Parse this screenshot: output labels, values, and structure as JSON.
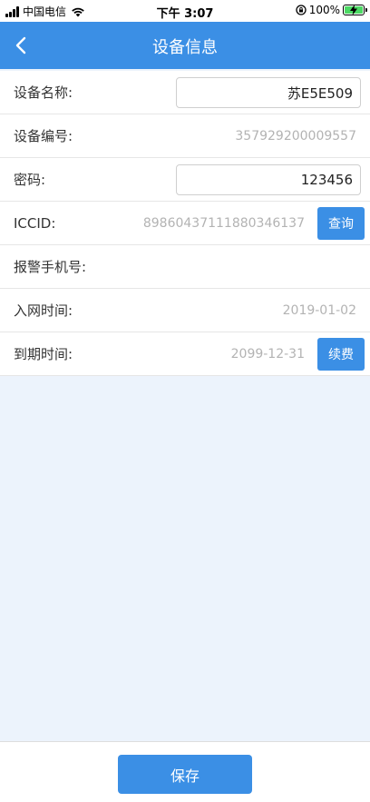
{
  "status_bar": {
    "carrier": "中国电信",
    "time": "下午 3:07",
    "battery": "100%"
  },
  "nav": {
    "title": "设备信息"
  },
  "form": {
    "device_name": {
      "label": "设备名称:",
      "value": "苏E5E509"
    },
    "device_number": {
      "label": "设备编号:",
      "value": "357929200009557"
    },
    "password": {
      "label": "密码:",
      "value": "123456"
    },
    "iccid": {
      "label": "ICCID:",
      "value": "89860437111880346137",
      "button": "查询"
    },
    "alarm_phone": {
      "label": "报警手机号:"
    },
    "network_time": {
      "label": "入网时间:",
      "value": "2019-01-02"
    },
    "expire_time": {
      "label": "到期时间:",
      "value": "2099-12-31",
      "button": "续费"
    }
  },
  "footer": {
    "save_label": "保存"
  },
  "colors": {
    "primary": "#3b8fe5",
    "background": "#ecf3fc"
  }
}
